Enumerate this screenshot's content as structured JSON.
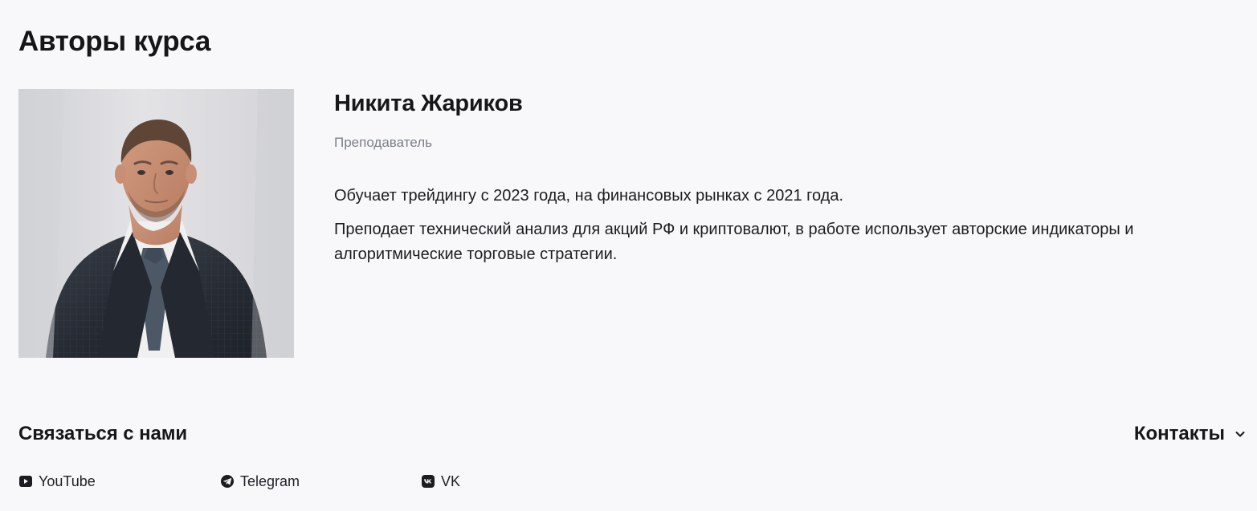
{
  "section": {
    "title": "Авторы курса"
  },
  "author": {
    "name": "Никита Жариков",
    "role": "Преподаватель",
    "bio": [
      "Обучает трейдингу с 2023 года, на финансовых рынках с 2021 года.",
      "Преподает технический анализ для акций РФ и криптовалют, в работе использует авторские индикаторы и алгоритмические торговые стратегии."
    ],
    "photo_icon": "author-photo"
  },
  "footer": {
    "title": "Связаться с нами",
    "contacts_label": "Контакты",
    "contacts_icon": "chevron-down-icon",
    "socials": [
      {
        "label": "YouTube",
        "icon": "youtube-icon"
      },
      {
        "label": "Telegram",
        "icon": "telegram-icon"
      },
      {
        "label": "VK",
        "icon": "vk-icon"
      }
    ]
  },
  "colors": {
    "background": "#f8f8fa",
    "text": "#1b1b1f",
    "muted_text": "#7c7f87",
    "photo_background": "#dcdce0",
    "suit": "#2b3038",
    "shirt": "#f3f3f4",
    "tie": "#4b5665"
  }
}
